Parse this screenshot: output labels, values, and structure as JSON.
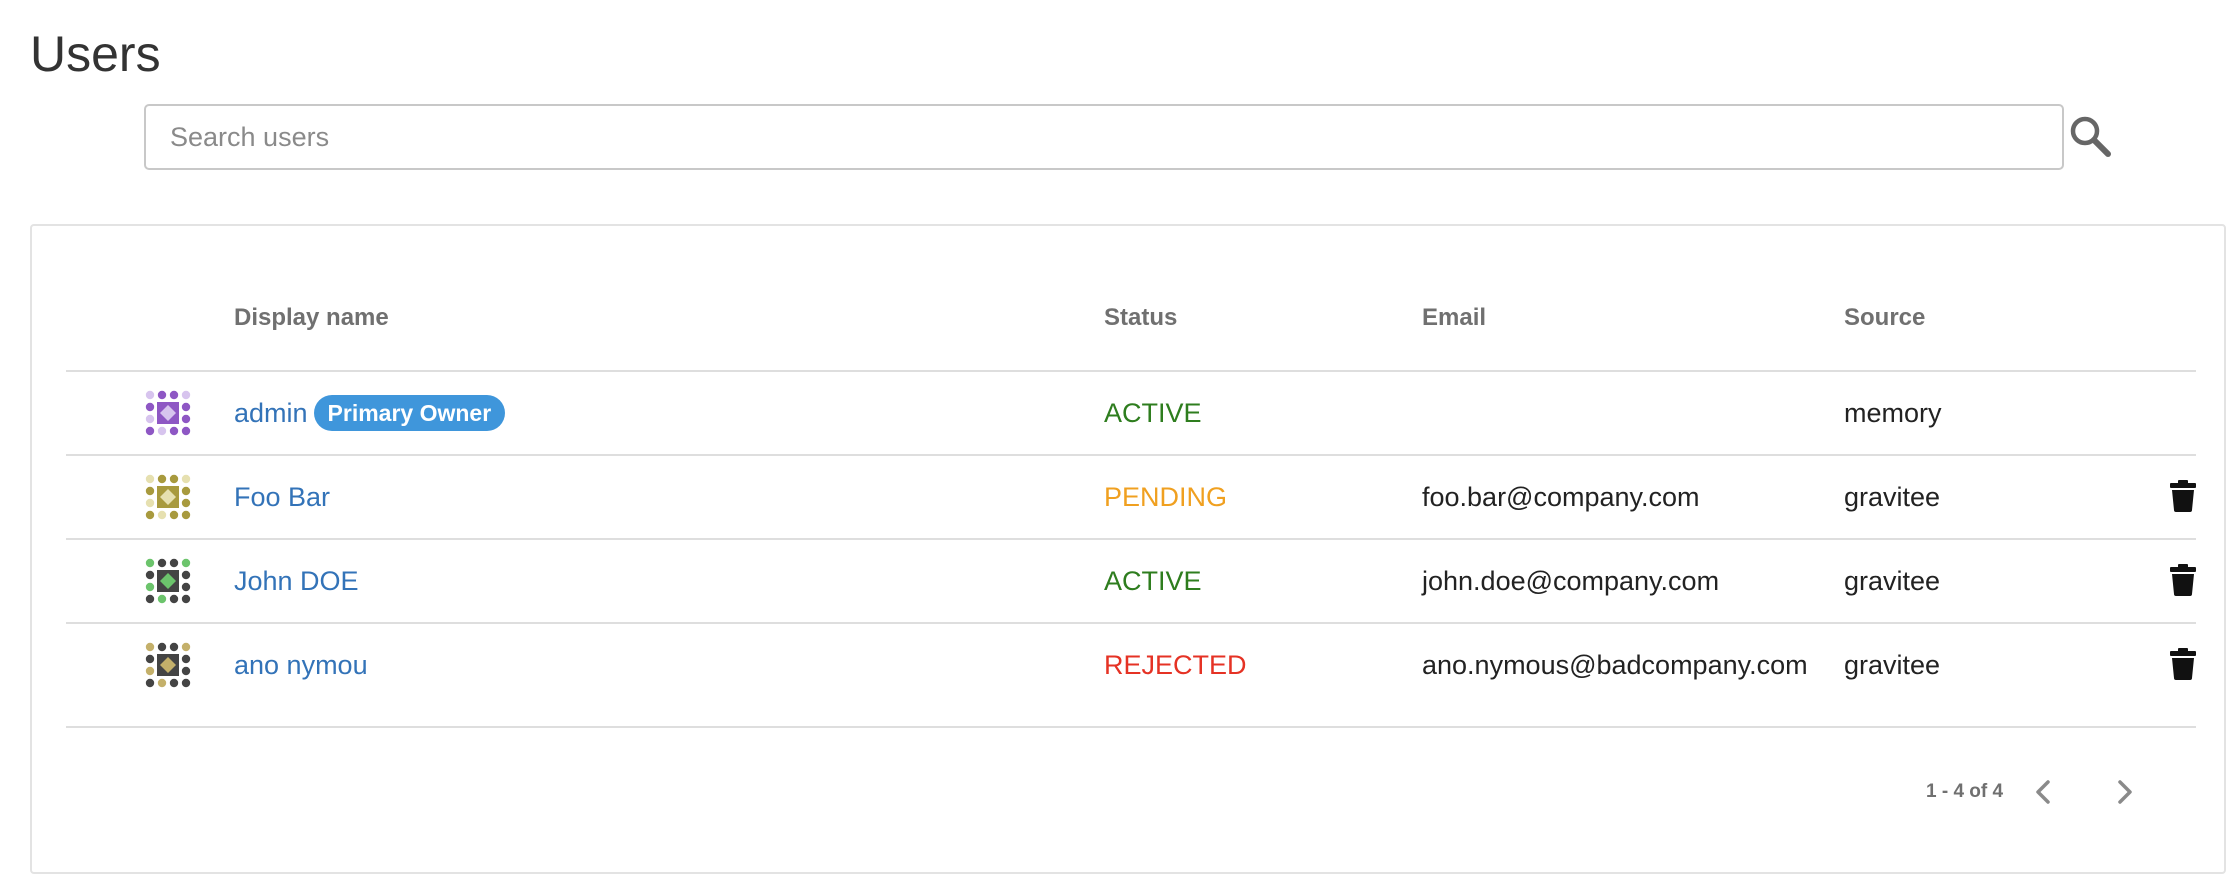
{
  "page": {
    "title": "Users"
  },
  "search": {
    "placeholder": "Search users",
    "value": "",
    "icon": "search-icon"
  },
  "table": {
    "headers": {
      "display_name": "Display name",
      "status": "Status",
      "email": "Email",
      "source": "Source"
    },
    "rows": [
      {
        "display_name": "admin",
        "badge": "Primary Owner",
        "status": "ACTIVE",
        "email": "",
        "source": "memory",
        "deletable": false,
        "avatar_colors": {
          "main": "#8e57c4",
          "light": "#d7c4ee"
        }
      },
      {
        "display_name": "Foo Bar",
        "badge": "",
        "status": "PENDING",
        "email": "foo.bar@company.com",
        "source": "gravitee",
        "deletable": true,
        "avatar_colors": {
          "main": "#a89a3e",
          "light": "#e6e0b0"
        }
      },
      {
        "display_name": "John DOE",
        "badge": "",
        "status": "ACTIVE",
        "email": "john.doe@company.com",
        "source": "gravitee",
        "deletable": true,
        "avatar_colors": {
          "main": "#444444",
          "light": "#6cc46c"
        }
      },
      {
        "display_name": "ano nymou",
        "badge": "",
        "status": "REJECTED",
        "email": "ano.nymous@badcompany.com",
        "source": "gravitee",
        "deletable": true,
        "avatar_colors": {
          "main": "#444444",
          "light": "#c4b06a"
        }
      }
    ]
  },
  "paginator": {
    "range_label": "1 - 4 of 4"
  },
  "colors": {
    "link": "#3373b8",
    "badge": "#3f96db",
    "status_active": "#2e7d1e",
    "status_pending": "#f0a020",
    "status_rejected": "#e53224"
  }
}
